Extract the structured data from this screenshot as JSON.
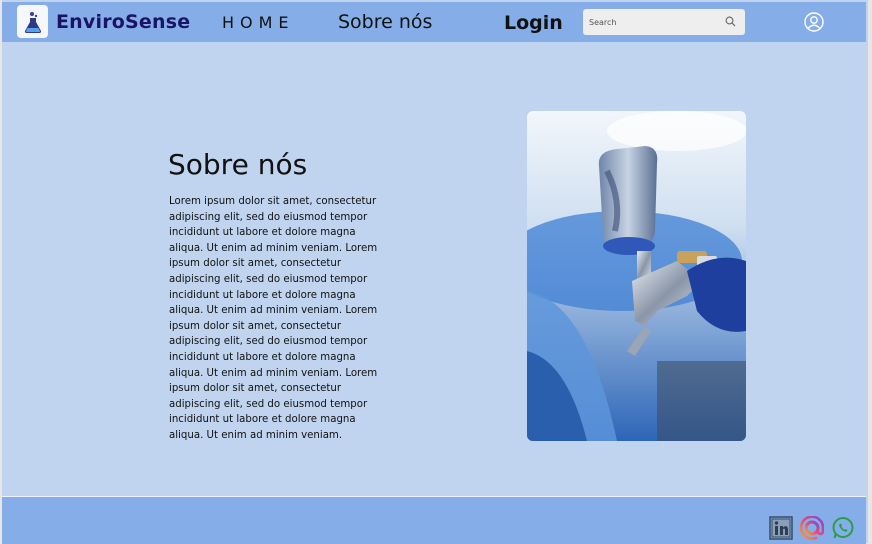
{
  "header": {
    "brand": "EnviroSense",
    "nav": {
      "home": "HOME",
      "about": "Sobre nós",
      "login": "Login"
    },
    "search": {
      "placeholder": "Search"
    }
  },
  "main": {
    "title": "Sobre nós",
    "paragraph": "Lorem ipsum dolor sit amet, consectetur adipiscing elit, sed do eiusmod tempor incididunt ut labore et dolore magna aliqua. Ut enim ad minim veniam. Lorem ipsum dolor sit amet, consectetur adipiscing elit, sed do eiusmod tempor incididunt ut labore et dolore magna aliqua. Ut enim ad minim veniam. Lorem ipsum dolor sit amet, consectetur adipiscing elit, sed do eiusmod tempor incididunt ut labore et dolore magna aliqua. Ut enim ad minim veniam. Lorem ipsum dolor sit amet, consectetur adipiscing elit, sed do eiusmod tempor incididunt ut labore et dolore magna aliqua. Ut enim ad minim veniam.",
    "image": "spray-gun-photo"
  },
  "icons": {
    "logo": "flask-logo-icon",
    "search": "search-icon",
    "user": "user-icon",
    "social": [
      "linkedin-icon",
      "instagram-threads-icon",
      "whatsapp-icon"
    ]
  },
  "colors": {
    "header_bg": "#85aee9",
    "page_bg": "#c0d4ef",
    "brand_text": "#1b1466"
  }
}
